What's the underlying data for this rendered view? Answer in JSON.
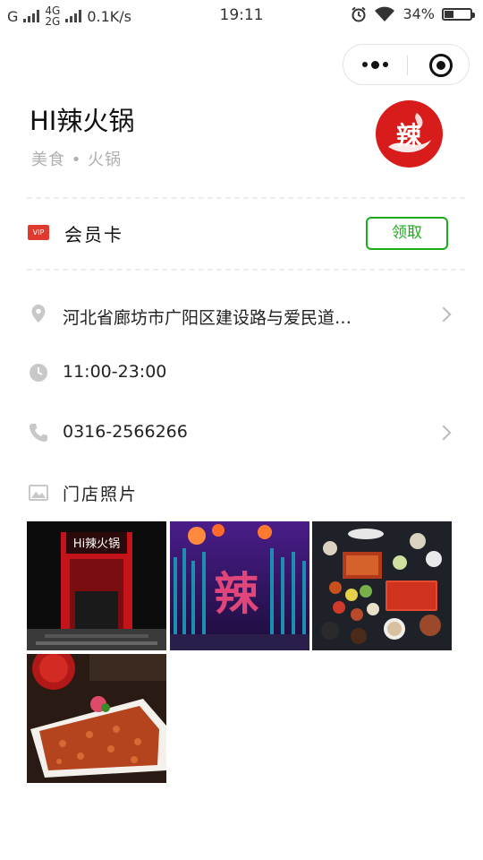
{
  "status_bar": {
    "carrier": "G",
    "network_top": "4G",
    "network_bottom": "2G",
    "speed": "0.1K/s",
    "time": "19:11",
    "battery": "34%",
    "battery_level": 0.34
  },
  "store": {
    "name": "HI辣火锅",
    "category": "美食 • 火锅",
    "logo_text": "辣"
  },
  "member_card": {
    "badge": "VIP",
    "label": "会员卡",
    "claim_button": "领取"
  },
  "info": {
    "address": "河北省廊坊市广阳区建设路与爱民道…",
    "hours": "11:00-23:00",
    "phone": "0316-2566266",
    "photos_label": "门店照片"
  },
  "photos": {
    "photo1_sign": "Hi辣火锅",
    "photo2_sign": "辣"
  },
  "colors": {
    "accent_green": "#1aad19",
    "logo_red": "#d81b1b",
    "vip_red": "#e03a2e"
  }
}
